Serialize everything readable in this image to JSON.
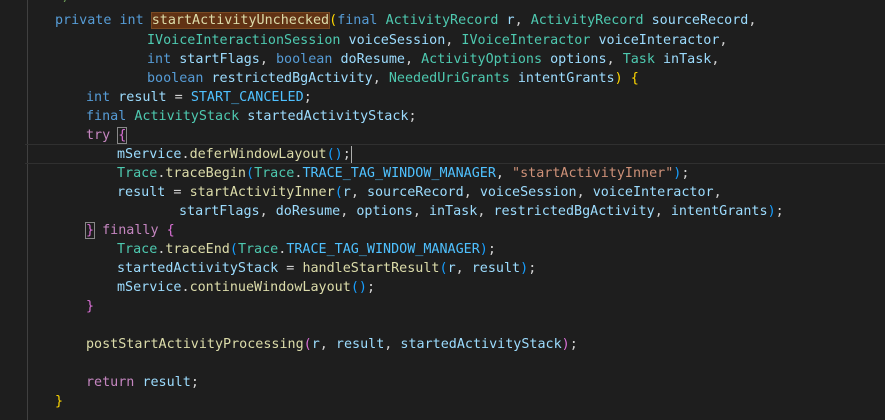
{
  "editor": {
    "language": "java",
    "method_name": "startActivityUnchecked"
  },
  "code": {
    "l0_comment": "*/",
    "l1_private": "private",
    "l1_int": "int",
    "l1_name": "startActivityUnchecked",
    "l1_paren": "(",
    "l1_final": "final",
    "l1_type1": "ActivityRecord",
    "l1_var1": "r",
    "l1_comma1": ", ",
    "l1_type2": "ActivityRecord",
    "l1_var2": "sourceRecord",
    "l1_comma2": ",",
    "l2_type1": "IVoiceInteractionSession",
    "l2_var1": "voiceSession",
    "l2_comma1": ", ",
    "l2_type2": "IVoiceInteractor",
    "l2_var2": "voiceInteractor",
    "l2_comma2": ",",
    "l3_int": "int",
    "l3_var1": "startFlags",
    "l3_comma1": ", ",
    "l3_bool": "boolean",
    "l3_var2": "doResume",
    "l3_comma2": ", ",
    "l3_type3": "ActivityOptions",
    "l3_var3": "options",
    "l3_comma3": ", ",
    "l3_type4": "Task",
    "l3_var4": "inTask",
    "l3_comma4": ",",
    "l4_bool": "boolean",
    "l4_var1": "restrictedBgActivity",
    "l4_comma1": ", ",
    "l4_type2": "NeededUriGrants",
    "l4_var2": "intentGrants",
    "l4_close": ")",
    "l4_brace": "{",
    "l5_int": "int",
    "l5_var": "result",
    "l5_eq": " = ",
    "l5_const": "START_CANCELED",
    "l5_semi": ";",
    "l6_final": "final",
    "l6_type": "ActivityStack",
    "l6_var": "startedActivityStack",
    "l6_semi": ";",
    "l7_try": "try",
    "l7_brace": "{",
    "l8_obj": "mService",
    "l8_dot": ".",
    "l8_fn": "deferWindowLayout",
    "l8_parens": "()",
    "l8_semi": ";",
    "l9_obj": "Trace",
    "l9_dot": ".",
    "l9_fn": "traceBegin",
    "l9_open": "(",
    "l9_cls": "Trace",
    "l9_dot2": ".",
    "l9_const": "TRACE_TAG_WINDOW_MANAGER",
    "l9_comma": ", ",
    "l9_str": "\"startActivityInner\"",
    "l9_close": ")",
    "l9_semi": ";",
    "l10_var": "result",
    "l10_eq": " = ",
    "l10_fn": "startActivityInner",
    "l10_open": "(",
    "l10_a1": "r",
    "l10_c1": ", ",
    "l10_a2": "sourceRecord",
    "l10_c2": ", ",
    "l10_a3": "voiceSession",
    "l10_c3": ", ",
    "l10_a4": "voiceInteractor",
    "l10_c4": ",",
    "l11_a1": "startFlags",
    "l11_c1": ", ",
    "l11_a2": "doResume",
    "l11_c2": ", ",
    "l11_a3": "options",
    "l11_c3": ", ",
    "l11_a4": "inTask",
    "l11_c4": ", ",
    "l11_a5": "restrictedBgActivity",
    "l11_c5": ", ",
    "l11_a6": "intentGrants",
    "l11_close": ")",
    "l11_semi": ";",
    "l12_brace": "}",
    "l12_finally": "finally",
    "l12_open": "{",
    "l13_obj": "Trace",
    "l13_dot": ".",
    "l13_fn": "traceEnd",
    "l13_open": "(",
    "l13_cls": "Trace",
    "l13_dot2": ".",
    "l13_const": "TRACE_TAG_WINDOW_MANAGER",
    "l13_close": ")",
    "l13_semi": ";",
    "l14_var": "startedActivityStack",
    "l14_eq": " = ",
    "l14_fn": "handleStartResult",
    "l14_open": "(",
    "l14_a1": "r",
    "l14_c1": ", ",
    "l14_a2": "result",
    "l14_close": ")",
    "l14_semi": ";",
    "l15_obj": "mService",
    "l15_dot": ".",
    "l15_fn": "continueWindowLayout",
    "l15_parens": "()",
    "l15_semi": ";",
    "l16_brace": "}",
    "l18_fn": "postStartActivityProcessing",
    "l18_open": "(",
    "l18_a1": "r",
    "l18_c1": ", ",
    "l18_a2": "result",
    "l18_c2": ", ",
    "l18_a3": "startedActivityStack",
    "l18_close": ")",
    "l18_semi": ";",
    "l20_return": "return",
    "l20_var": "result",
    "l20_semi": ";",
    "l21_brace": "}"
  },
  "theme": {
    "background": "#1e1e1e",
    "keyword": "#569cd6",
    "control": "#c586c0",
    "type": "#4ec9b0",
    "function": "#dcdcaa",
    "variable": "#9cdcfe",
    "constant": "#4fc1ff",
    "string": "#ce9178",
    "bracket_level1": "#ffd700",
    "bracket_level2": "#da70d6",
    "bracket_level3": "#179fff"
  }
}
